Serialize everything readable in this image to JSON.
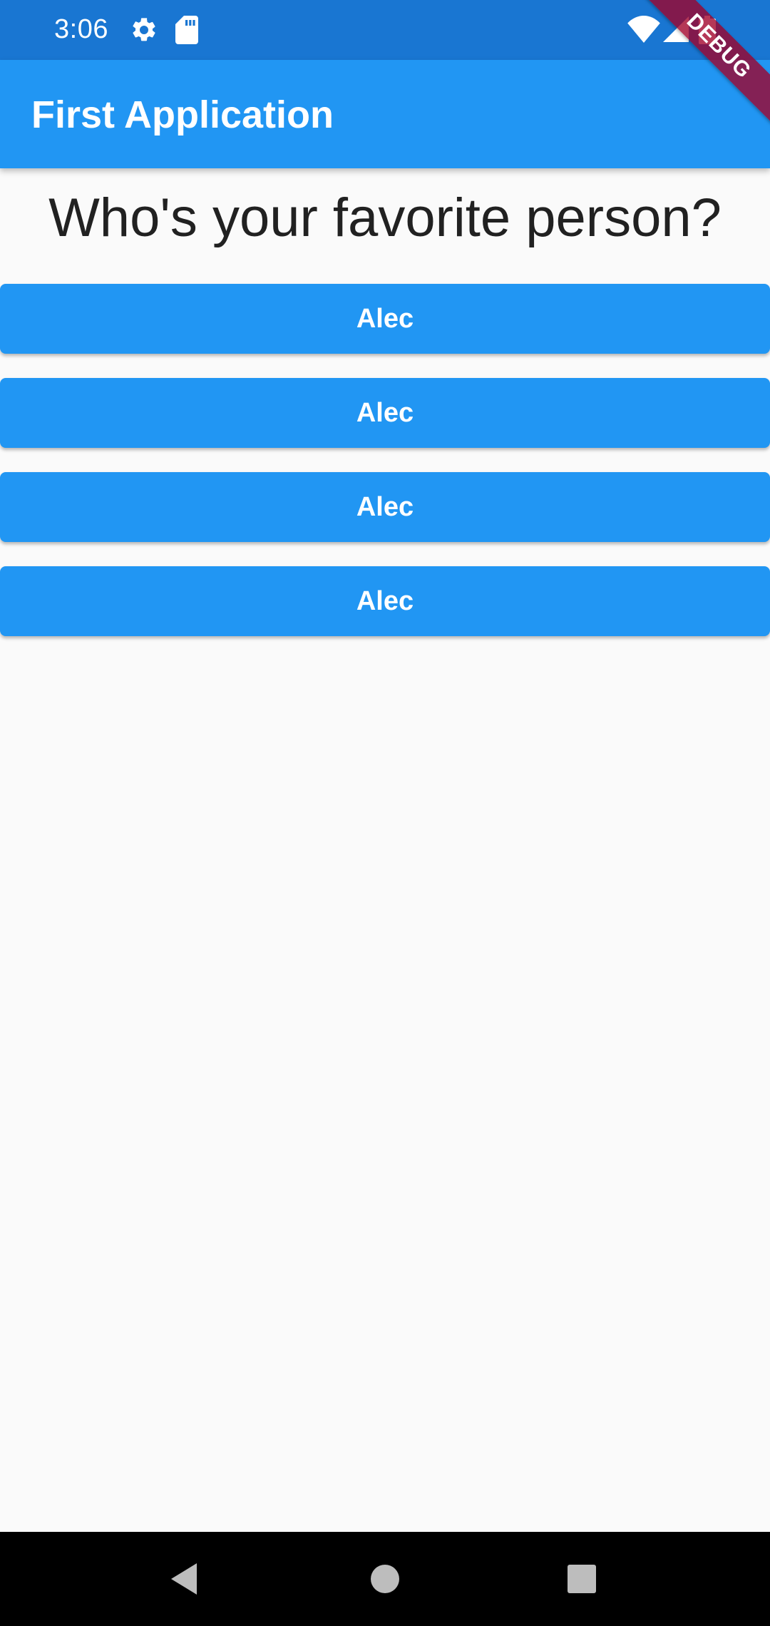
{
  "status_bar": {
    "time": "3:06",
    "icons": [
      "gear-icon",
      "sd-card-icon",
      "wifi-icon",
      "signal-icon",
      "battery-icon"
    ]
  },
  "debug_banner": "DEBUG",
  "app_bar": {
    "title": "First Application",
    "color": "#2196f3"
  },
  "question": "Who's your favorite person?",
  "answers": [
    {
      "label": "Alec"
    },
    {
      "label": "Alec"
    },
    {
      "label": "Alec"
    },
    {
      "label": "Alec"
    }
  ],
  "nav_bar": {
    "buttons": [
      "back-icon",
      "home-icon",
      "recents-icon"
    ]
  }
}
